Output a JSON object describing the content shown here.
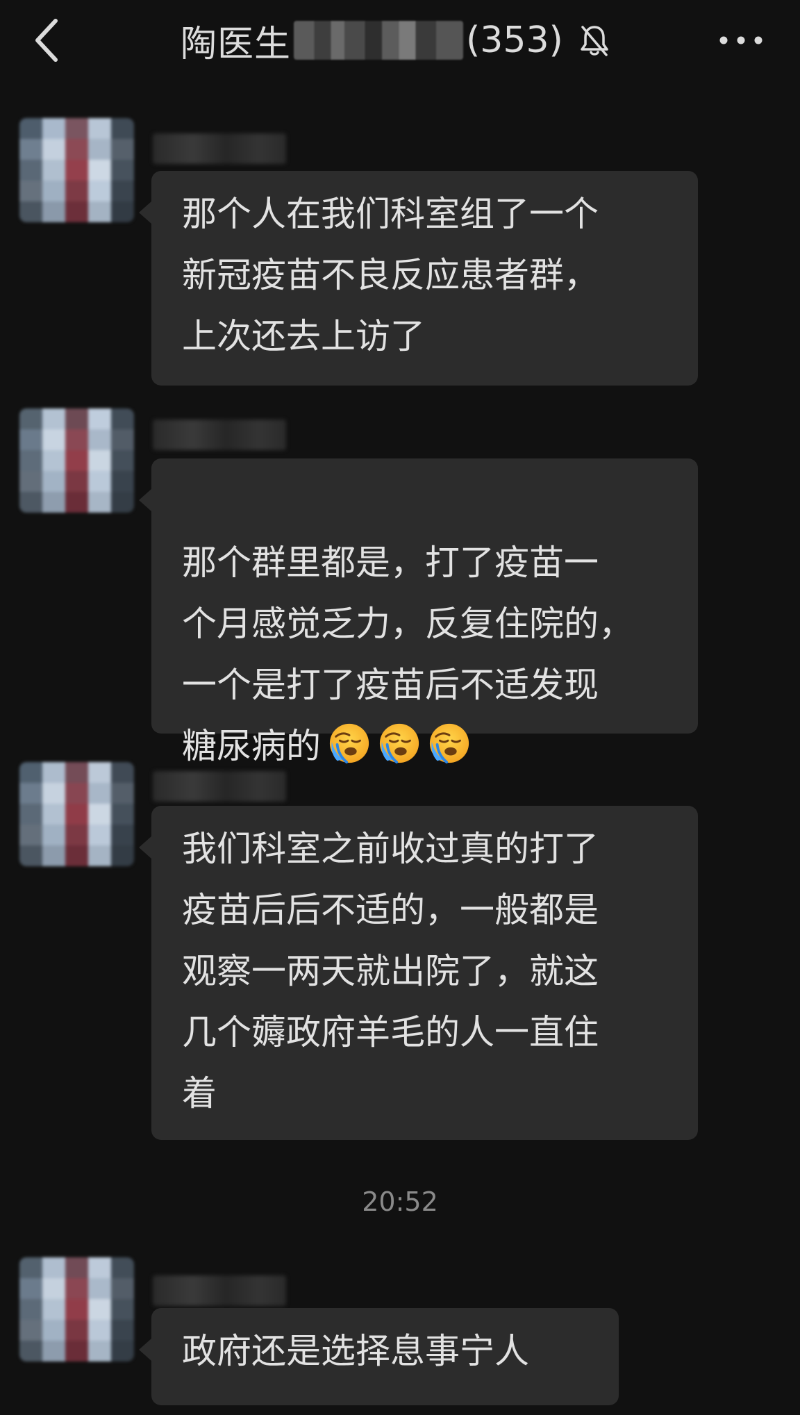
{
  "header": {
    "back_icon": "chevron-left-icon",
    "title_name": "陶医生",
    "title_count": "(353)",
    "mute_icon": "bell-off-icon",
    "more_icon": "more-horizontal-icon"
  },
  "messages": [
    {
      "text": "那个人在我们科室组了一个\n新冠疫苗不良反应患者群，\n上次还去上访了"
    },
    {
      "text": "那个群里都是，打了疫苗一\n个月感觉乏力，反复住院的，\n一个是打了疫苗后不适发现\n糖尿病的",
      "emoji": "loudly-crying-face",
      "emoji_count": 3
    },
    {
      "text": "我们科室之前收过真的打了\n疫苗后后不适的，一般都是\n观察一两天就出院了，就这\n几个薅政府羊毛的人一直住\n着"
    },
    {
      "text": "政府还是选择息事宁人"
    }
  ],
  "timestamp": "20:52",
  "colors": {
    "background": "#111111",
    "bubble": "#2c2c2c",
    "text": "#e2e2e2",
    "timestamp": "#8a8a8a"
  }
}
